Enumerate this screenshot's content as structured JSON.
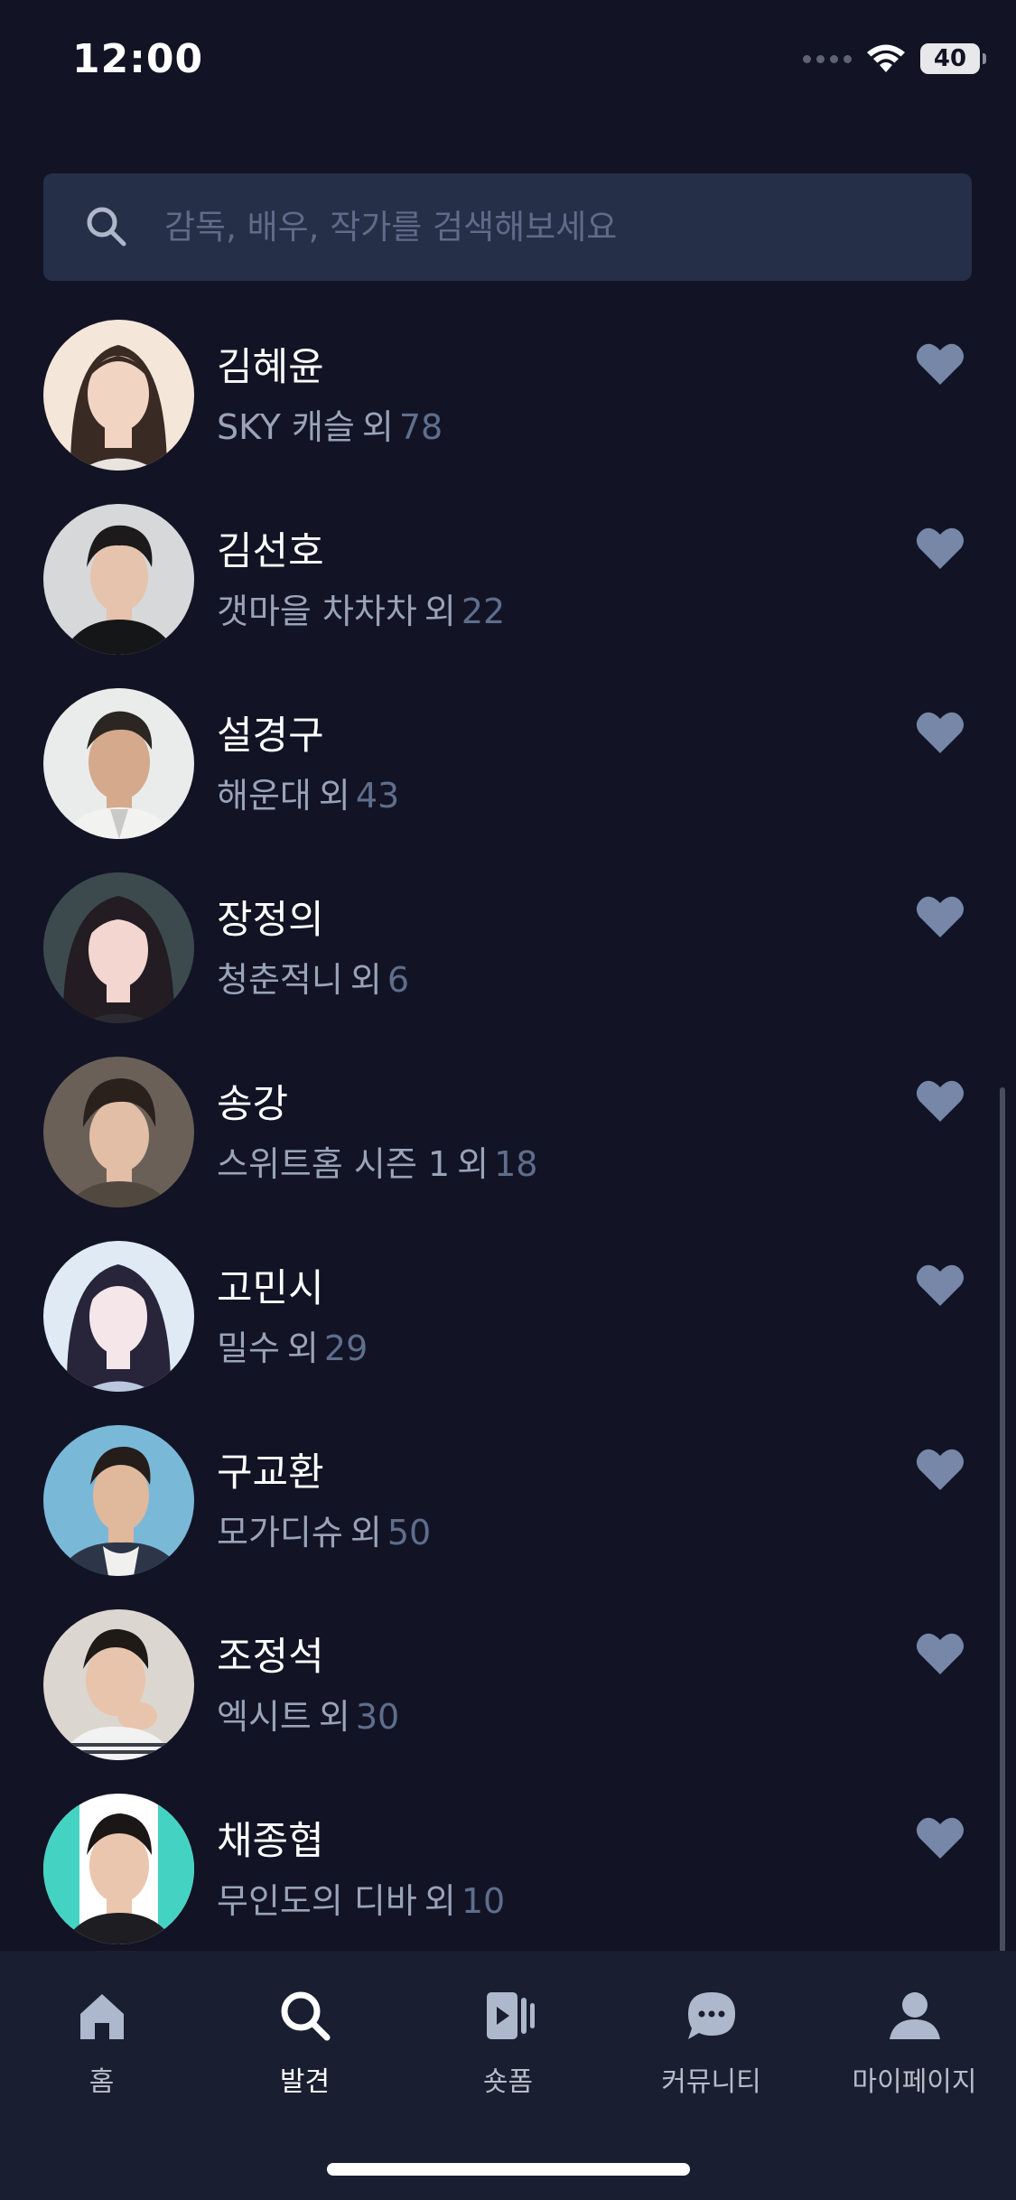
{
  "status_bar": {
    "time": "12:00",
    "battery": "40"
  },
  "search": {
    "placeholder": "감독, 배우, 작가를 검색해보세요"
  },
  "people": [
    {
      "name": "김혜윤",
      "work": "SKY 캐슬",
      "suffix": "외",
      "count": "78",
      "favorited": true
    },
    {
      "name": "김선호",
      "work": "갯마을 차차차",
      "suffix": "외",
      "count": "22",
      "favorited": true
    },
    {
      "name": "설경구",
      "work": "해운대",
      "suffix": "외",
      "count": "43",
      "favorited": true
    },
    {
      "name": "장정의",
      "work": "청춘적니",
      "suffix": "외",
      "count": "6",
      "favorited": true
    },
    {
      "name": "송강",
      "work": "스위트홈 시즌 1",
      "suffix": "외",
      "count": "18",
      "favorited": true
    },
    {
      "name": "고민시",
      "work": "밀수",
      "suffix": "외",
      "count": "29",
      "favorited": true
    },
    {
      "name": "구교환",
      "work": "모가디슈",
      "suffix": "외",
      "count": "50",
      "favorited": true
    },
    {
      "name": "조정석",
      "work": "엑시트",
      "suffix": "외",
      "count": "30",
      "favorited": true
    },
    {
      "name": "채종협",
      "work": "무인도의 디바",
      "suffix": "외",
      "count": "10",
      "favorited": true
    }
  ],
  "tab_bar": {
    "tabs": [
      {
        "label": "홈",
        "icon": "home-icon"
      },
      {
        "label": "발견",
        "icon": "search-icon"
      },
      {
        "label": "숏폼",
        "icon": "shortform-icon"
      },
      {
        "label": "커뮤니티",
        "icon": "chat-bubble-icon"
      },
      {
        "label": "마이페이지",
        "icon": "person-icon"
      }
    ],
    "active_tab": "발견"
  },
  "colors": {
    "background": "#121425",
    "search_background": "#262f48",
    "heart": "#7687a8",
    "count": "#5f6e8c",
    "tab_bar": "#1a1e31"
  }
}
